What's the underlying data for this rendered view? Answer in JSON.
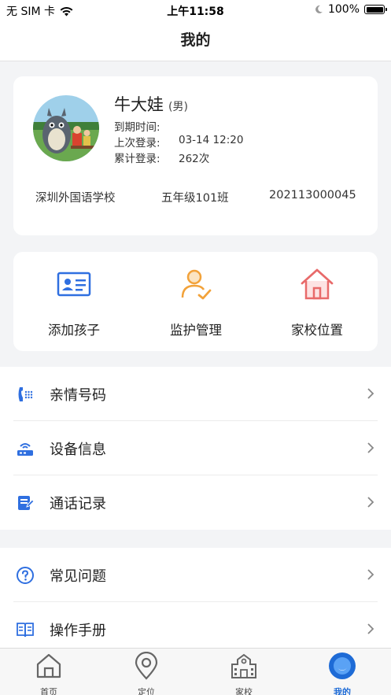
{
  "status_bar": {
    "carrier": "无 SIM 卡",
    "time": "上午11:58",
    "battery": "100%"
  },
  "header": {
    "title": "我的"
  },
  "profile": {
    "name": "牛大娃",
    "gender": "(男)",
    "expiry_label": "到期时间:",
    "expiry_value": "",
    "last_login_label": "上次登录:",
    "last_login_value": "03-14 12:20",
    "total_login_label": "累计登录:",
    "total_login_value": "262次",
    "school": "深圳外国语学校",
    "class": "五年级101班",
    "student_id": "202113000045"
  },
  "quick_actions": [
    {
      "label": "添加孩子",
      "icon": "id-card-icon"
    },
    {
      "label": "监护管理",
      "icon": "guardian-user-icon"
    },
    {
      "label": "家校位置",
      "icon": "home-icon"
    }
  ],
  "menu_group_1": [
    {
      "label": "亲情号码",
      "icon": "phone-icon"
    },
    {
      "label": "设备信息",
      "icon": "device-icon"
    },
    {
      "label": "通话记录",
      "icon": "call-log-icon"
    }
  ],
  "menu_group_2": [
    {
      "label": "常见问题",
      "icon": "question-icon"
    },
    {
      "label": "操作手册",
      "icon": "manual-icon"
    }
  ],
  "tabs": [
    {
      "label": "首页",
      "icon": "home-tab-icon"
    },
    {
      "label": "定位",
      "icon": "location-pin-icon"
    },
    {
      "label": "家校",
      "icon": "school-building-icon"
    },
    {
      "label": "我的",
      "icon": "profile-tab-icon"
    }
  ],
  "colors": {
    "accent_blue": "#2f6fe0",
    "orange": "#f2a23a",
    "red": "#e86a6a",
    "active_tab": "#1e6bd6"
  }
}
